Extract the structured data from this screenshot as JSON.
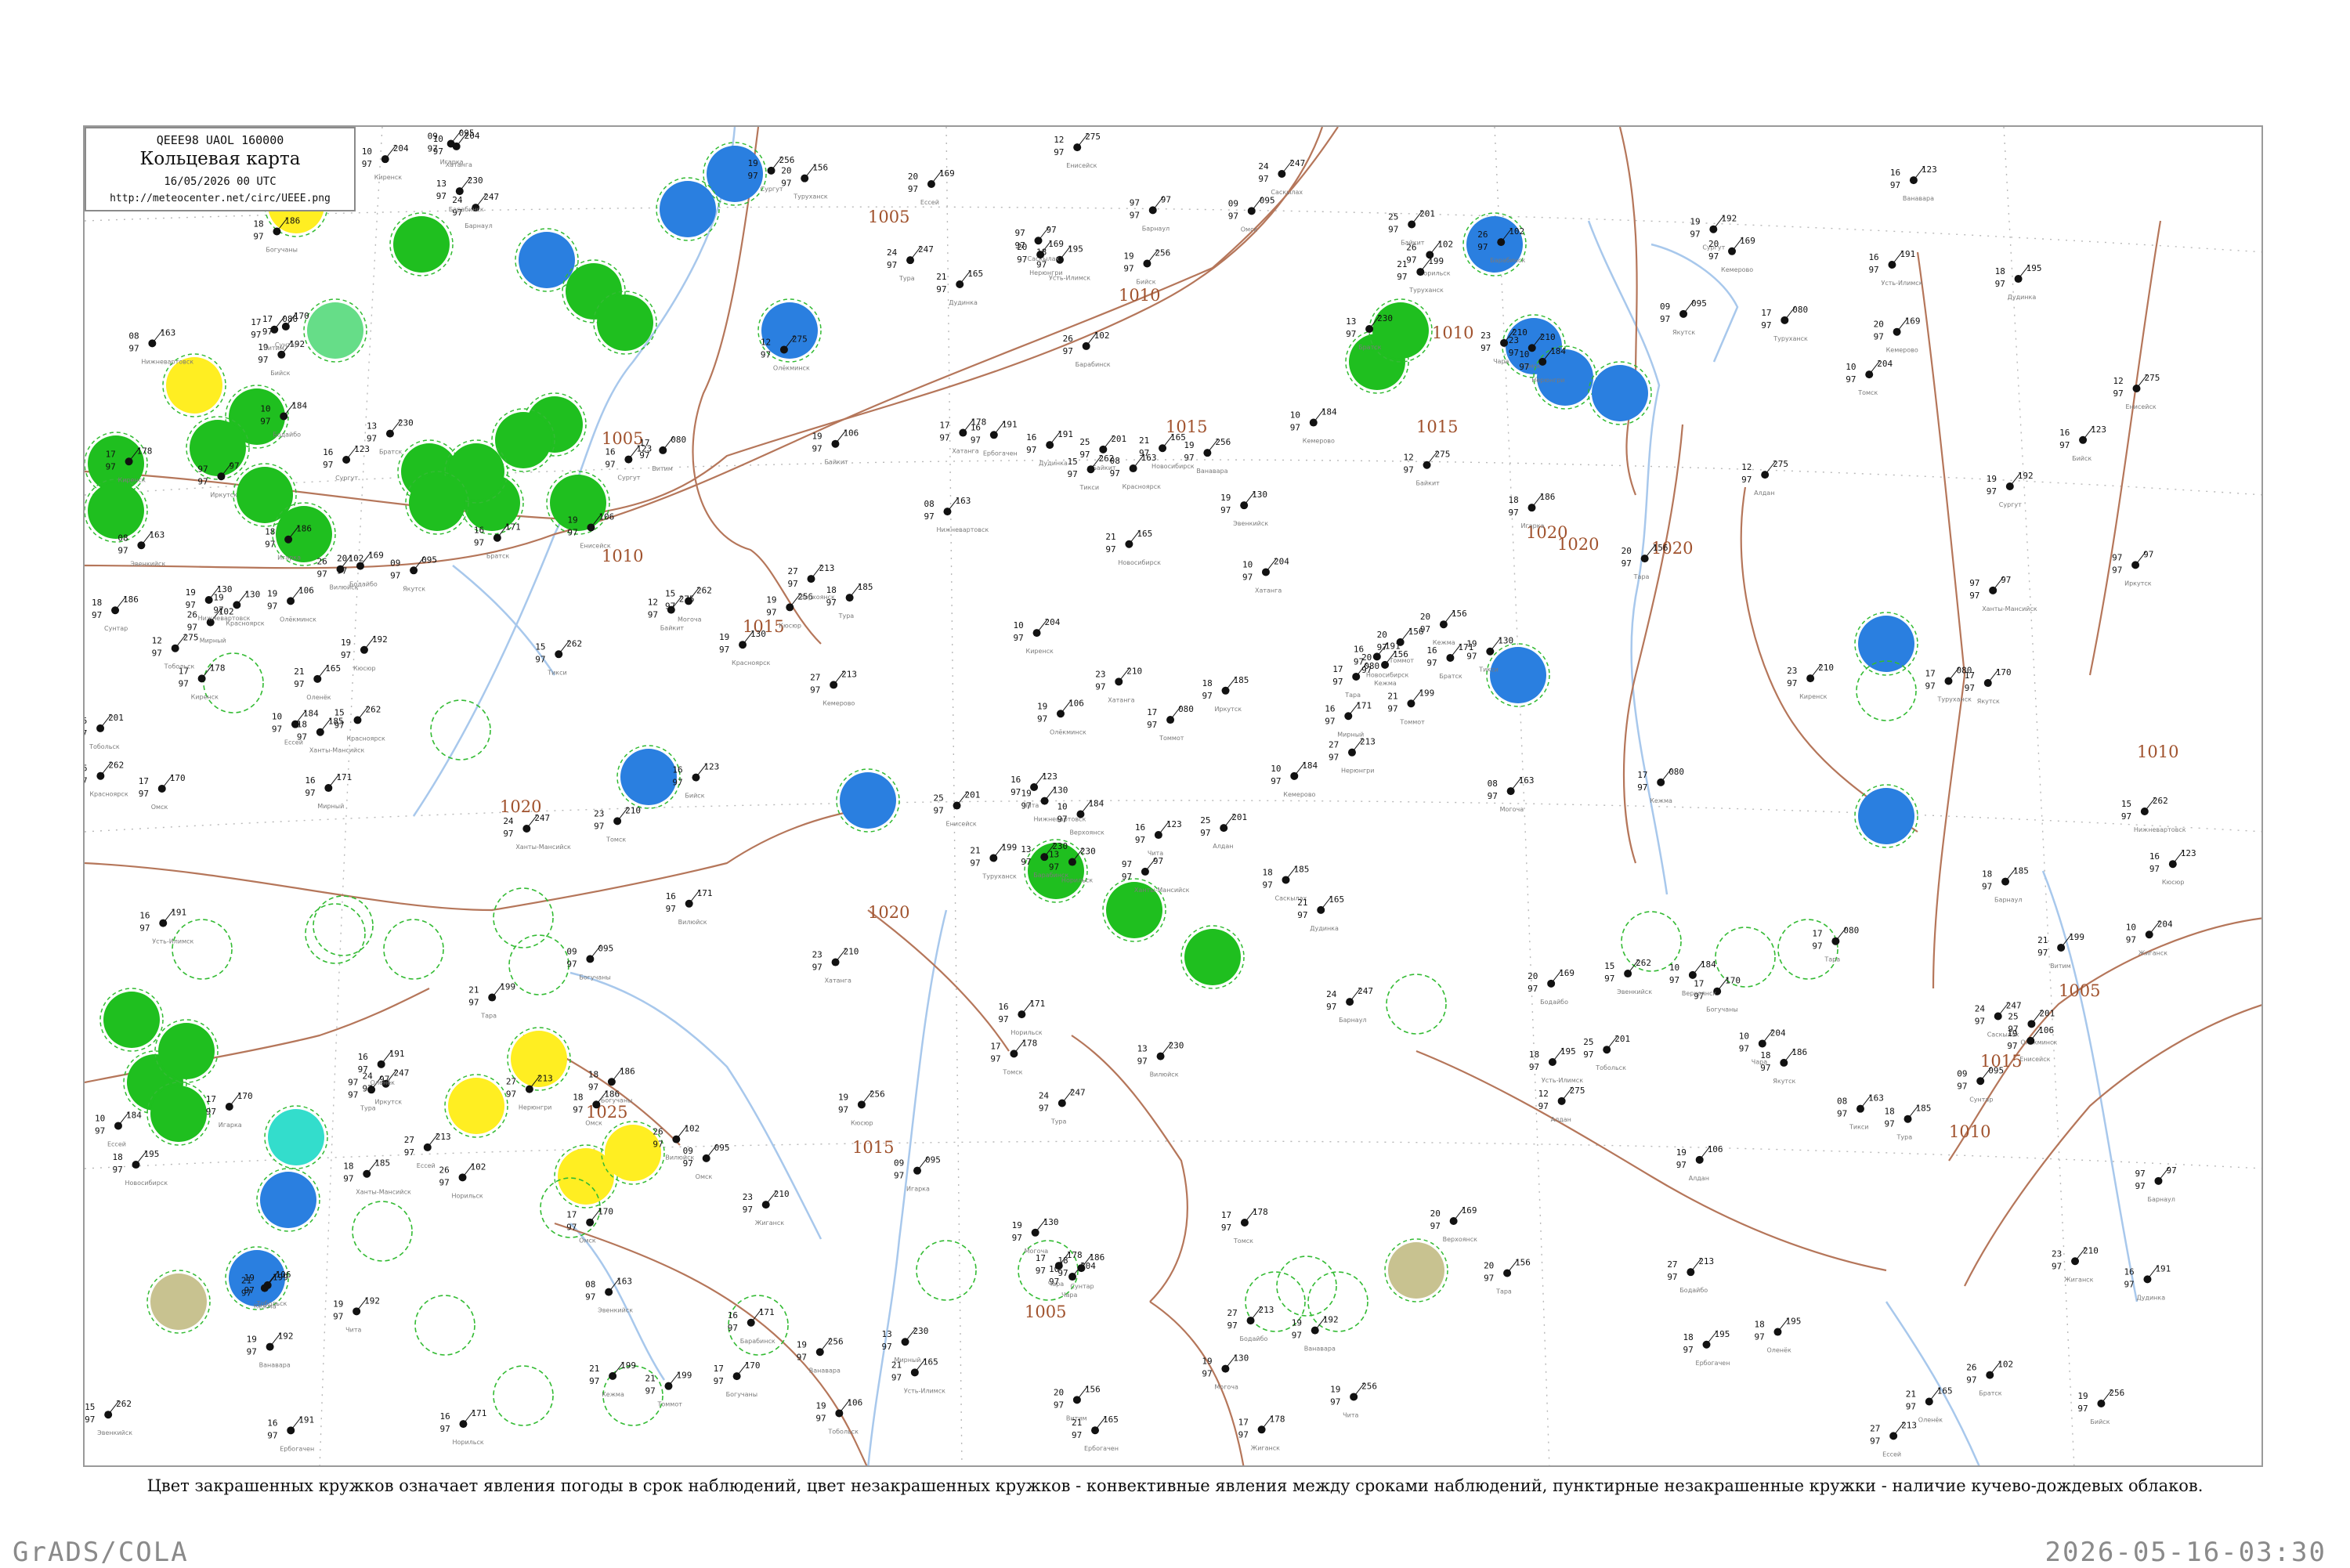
{
  "legend": {
    "line1": "QEEE98  UAOL  160000",
    "title": "Кольцевая карта",
    "date": "16/05/2026 00 UTC",
    "url": "http://meteocenter.net/circ/UEEE.png"
  },
  "caption": "Цвет закрашенных кружков означает явления погоды в срок наблюдений, цвет незакрашенных кружков - конвективные явления между сроками наблюдений, пунктирные незакрашенные кружки - наличие кучево-дождевых облаков.",
  "footer": {
    "left": "GrADS/COLA",
    "right": "2026-05-16-03:30"
  },
  "colors": {
    "isobar": "#b5765a",
    "river": "#a8c8ec",
    "dashed_ring": "#33bb33",
    "green": "#1fbf1f",
    "blue": "#2a7fe0",
    "yellow": "#ffee22",
    "lightgreen": "#66dd88",
    "cyan": "#33ddcc",
    "olive": "#c8c290"
  },
  "isobar_labels": [
    "1005",
    "1010",
    "1015",
    "1020",
    "1025"
  ],
  "station_names": [
    "Ханты-Мансийск",
    "Сургут",
    "Нижневартовск",
    "Тобольск",
    "Тара",
    "Омск",
    "Барабинск",
    "Новосибирск",
    "Томск",
    "Кемерово",
    "Барнаул",
    "Бийск",
    "Красноярск",
    "Енисейск",
    "Туруханск",
    "Игарка",
    "Норильск",
    "Дудинка",
    "Хатанга",
    "Ессей",
    "Тура",
    "Ванавара",
    "Эвенкийск",
    "Байкит",
    "Кежма",
    "Богучаны",
    "Братск",
    "Усть-Илимск",
    "Киренск",
    "Бодайбо",
    "Иркутск",
    "Чита",
    "Могоча",
    "Олёкминск",
    "Витим",
    "Якутск",
    "Вилюйск",
    "Оленёк",
    "Жиганск",
    "Верхоянск",
    "Саскылах",
    "Кюсюр",
    "Тикси",
    "Алдан",
    "Томмот",
    "Сунтар",
    "Мирный",
    "Ербогачен",
    "Чара",
    "Нерюнгри"
  ],
  "station_values": [
    "97",
    "123",
    "130",
    "106",
    "080",
    "095",
    "102",
    "165",
    "210",
    "184",
    "247",
    "256",
    "262",
    "275",
    "199",
    "186",
    "171",
    "191",
    "204",
    "213",
    "185",
    "192",
    "163",
    "201",
    "156",
    "170",
    "230",
    "195",
    "178",
    "169"
  ]
}
